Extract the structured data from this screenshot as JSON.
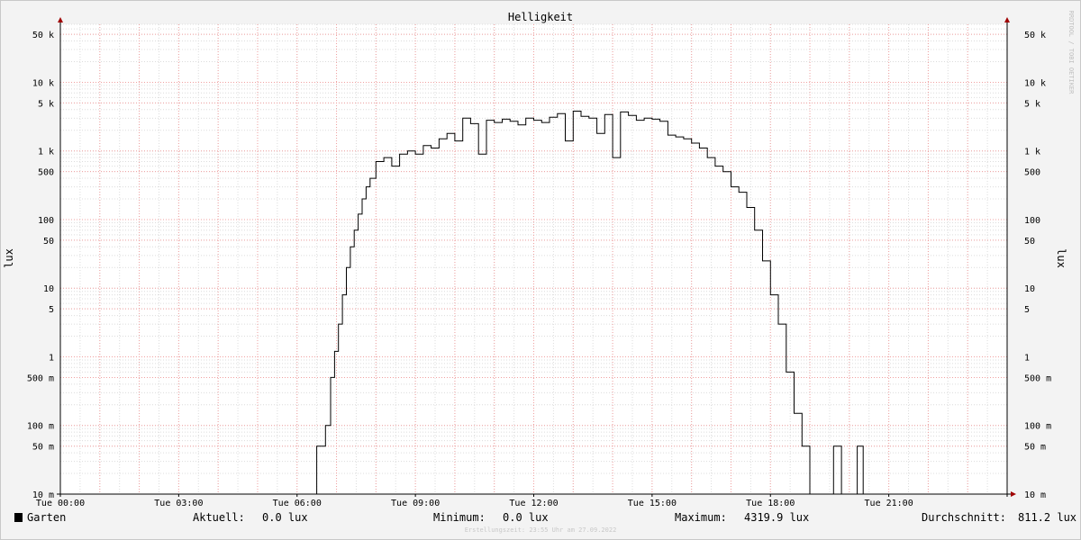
{
  "chart_data": {
    "type": "line",
    "title": "Helligkeit",
    "ylabel": "lux",
    "ylabel_right": "lux",
    "yscale": "log",
    "ylim": [
      0.01,
      70000
    ],
    "xlim": [
      "00:00",
      "24:00"
    ],
    "grid": true,
    "x_ticks": [
      "Tue 00:00",
      "Tue 03:00",
      "Tue 06:00",
      "Tue 09:00",
      "Tue 12:00",
      "Tue 15:00",
      "Tue 18:00",
      "Tue 21:00"
    ],
    "y_ticks": [
      {
        "value": 50000,
        "label": "50 k"
      },
      {
        "value": 10000,
        "label": "10 k"
      },
      {
        "value": 5000,
        "label": "5 k"
      },
      {
        "value": 1000,
        "label": "1 k"
      },
      {
        "value": 500,
        "label": "500"
      },
      {
        "value": 100,
        "label": "100"
      },
      {
        "value": 50,
        "label": "50"
      },
      {
        "value": 10,
        "label": "10"
      },
      {
        "value": 5,
        "label": "5"
      },
      {
        "value": 1,
        "label": "1"
      },
      {
        "value": 0.5,
        "label": "500 m"
      },
      {
        "value": 0.1,
        "label": "100 m"
      },
      {
        "value": 0.05,
        "label": "50 m"
      },
      {
        "value": 0.01,
        "label": "10 m"
      }
    ],
    "series": [
      {
        "name": "Garten",
        "color": "#000000",
        "x_hours": [
          0,
          6.5,
          6.55,
          6.72,
          6.85,
          6.95,
          7.05,
          7.15,
          7.25,
          7.35,
          7.45,
          7.55,
          7.65,
          7.75,
          7.85,
          8.0,
          8.2,
          8.4,
          8.6,
          8.8,
          9.0,
          9.2,
          9.4,
          9.6,
          9.8,
          10.0,
          10.2,
          10.4,
          10.6,
          10.8,
          11.0,
          11.2,
          11.4,
          11.6,
          11.8,
          12.0,
          12.2,
          12.4,
          12.6,
          12.8,
          13.0,
          13.2,
          13.4,
          13.6,
          13.8,
          14.0,
          14.2,
          14.4,
          14.6,
          14.8,
          15.0,
          15.2,
          15.4,
          15.6,
          15.8,
          16.0,
          16.2,
          16.4,
          16.6,
          16.8,
          17.0,
          17.2,
          17.4,
          17.6,
          17.8,
          18.0,
          18.2,
          18.4,
          18.6,
          18.8,
          19.0,
          19.2,
          19.4,
          19.5,
          19.6,
          19.7,
          19.8,
          19.9,
          20.0,
          20.1,
          20.2,
          20.25,
          20.35,
          20.4,
          20.8,
          20.85,
          20.9,
          20.95,
          21.9,
          21.95,
          22.05,
          22.1,
          24.0
        ],
        "y_values": [
          0.01,
          0.05,
          0.05,
          0.1,
          0.5,
          1.2,
          3,
          8,
          20,
          40,
          70,
          120,
          200,
          300,
          400,
          700,
          800,
          600,
          900,
          1000,
          900,
          1200,
          1100,
          1500,
          1800,
          1400,
          3000,
          2500,
          900,
          2800,
          2600,
          2900,
          2700,
          2400,
          3000,
          2800,
          2600,
          3100,
          3500,
          1400,
          3800,
          3200,
          3000,
          1800,
          3400,
          800,
          3700,
          3300,
          2800,
          3000,
          2900,
          2700,
          1700,
          1600,
          1500,
          1300,
          1100,
          800,
          600,
          500,
          300,
          250,
          150,
          70,
          25,
          8,
          3,
          0.6,
          0.15,
          0.05,
          0.01,
          0.01,
          0.01,
          0.01,
          0.05,
          0.05,
          0.01,
          0.01,
          0.01,
          0.01,
          0.05,
          0.05,
          0.01,
          0.01,
          0.01
        ]
      }
    ],
    "legend": {
      "entries": [
        "Garten"
      ],
      "current_label": "Aktuell:",
      "current_value": "0.0 lux",
      "min_label": "Minimum:",
      "min_value": "0.0 lux",
      "max_label": "Maximum:",
      "max_value": "4319.9 lux",
      "avg_label": "Durchschnitt:",
      "avg_value": "811.2 lux"
    },
    "side_credit": "RRDTOOL / TOBI OETIKER",
    "footer": "Erstellungszeit: 23:55 Uhr am 27.09.2022"
  }
}
